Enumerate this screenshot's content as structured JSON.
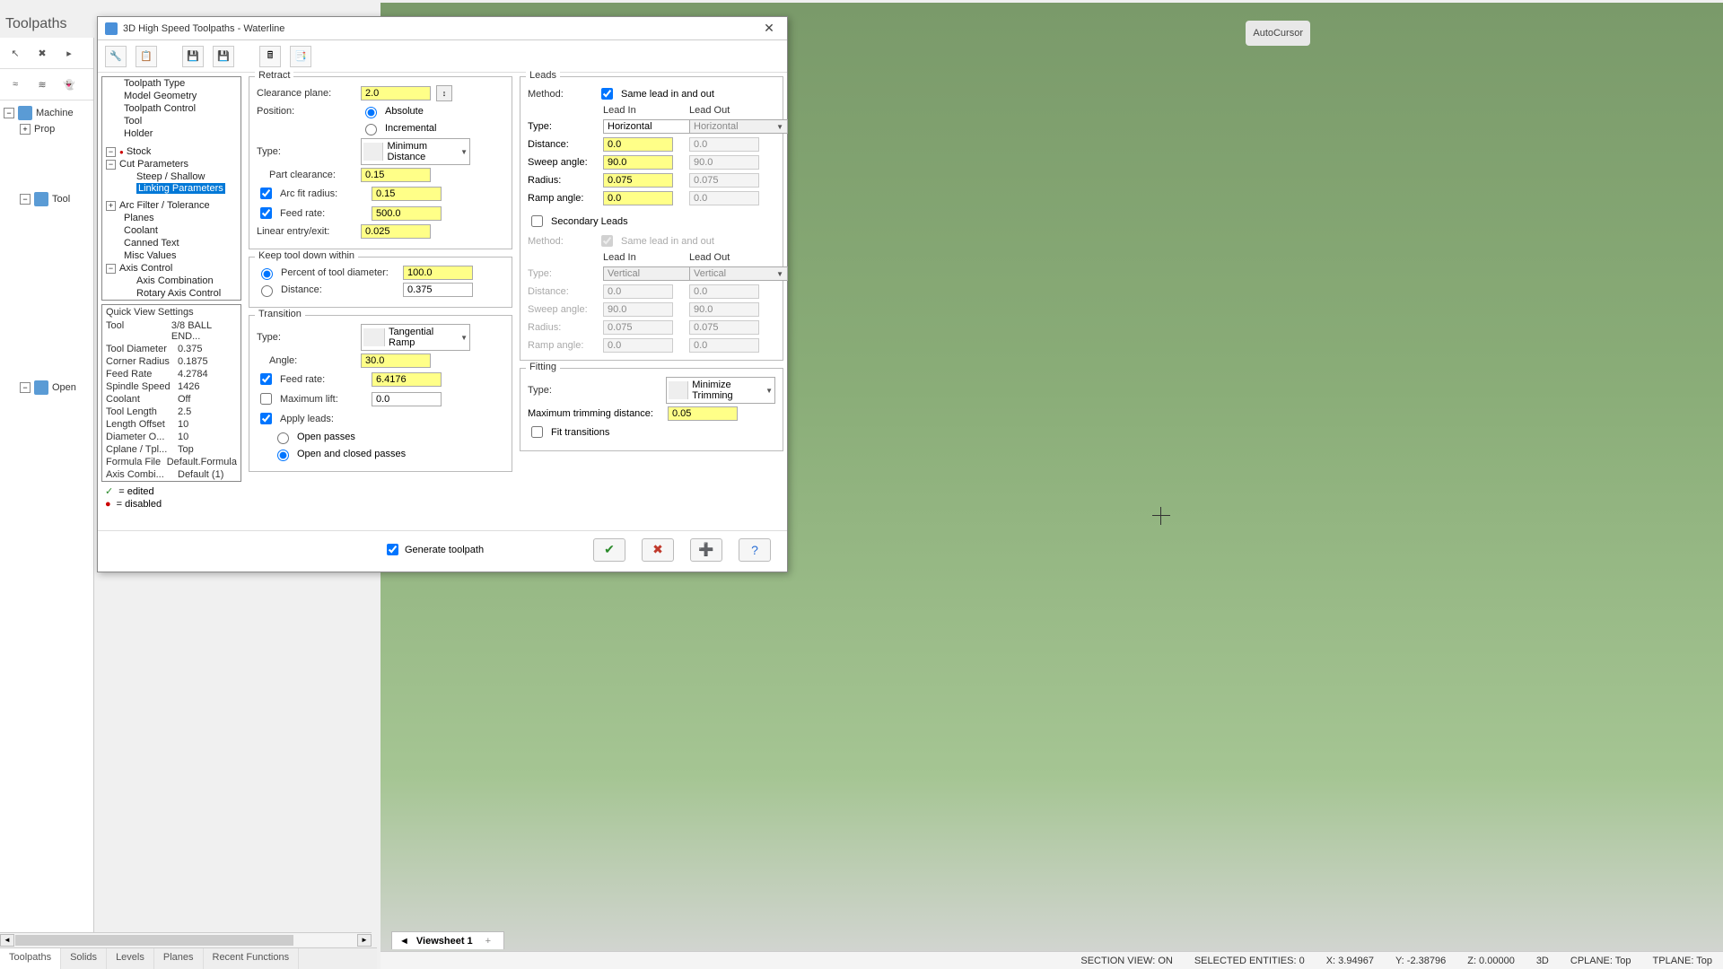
{
  "panel_title": "Toolpaths",
  "sidebar_tree": {
    "machine": "Machine",
    "properties": "Prop",
    "toolpath": "Tool",
    "operations": "Open"
  },
  "bottom_tabs": [
    "Toolpaths",
    "Solids",
    "Levels",
    "Planes",
    "Recent Functions"
  ],
  "viewport_toolbar": {
    "autocursor": "AutoCursor"
  },
  "viewsheet": {
    "label": "Viewsheet 1"
  },
  "status": {
    "section": "SECTION VIEW: ON",
    "selected": "SELECTED ENTITIES: 0",
    "x": "X: 3.94967",
    "y": "Y: -2.38796",
    "z": "Z: 0.00000",
    "mode": "3D",
    "cplane": "CPLANE: Top",
    "tplane": "TPLANE: Top"
  },
  "dialog": {
    "title": "3D High Speed Toolpaths - Waterline",
    "tree": [
      "Toolpath Type",
      "Model Geometry",
      "Toolpath Control",
      "Tool",
      "Holder",
      "Stock",
      "Cut Parameters",
      "Steep / Shallow",
      "Linking Parameters",
      "Arc Filter / Tolerance",
      "Planes",
      "Coolant",
      "Canned Text",
      "Misc Values",
      "Axis Control",
      "Axis Combination",
      "Rotary Axis Control"
    ],
    "quickview_title": "Quick View Settings",
    "quickview": [
      {
        "l": "Tool",
        "v": "3/8 BALL END..."
      },
      {
        "l": "Tool Diameter",
        "v": "0.375"
      },
      {
        "l": "Corner Radius",
        "v": "0.1875"
      },
      {
        "l": "Feed Rate",
        "v": "4.2784"
      },
      {
        "l": "Spindle Speed",
        "v": "1426"
      },
      {
        "l": "Coolant",
        "v": "Off"
      },
      {
        "l": "Tool Length",
        "v": "2.5"
      },
      {
        "l": "Length Offset",
        "v": "10"
      },
      {
        "l": "Diameter O...",
        "v": "10"
      },
      {
        "l": "Cplane / Tpl...",
        "v": "Top"
      },
      {
        "l": "Formula File",
        "v": "Default.Formula"
      },
      {
        "l": "Axis Combi...",
        "v": "Default (1)"
      }
    ],
    "legend": {
      "edited": "= edited",
      "disabled": "= disabled"
    },
    "retract": {
      "title": "Retract",
      "clearance_label": "Clearance plane:",
      "clearance": "2.0",
      "position_label": "Position:",
      "absolute": "Absolute",
      "incremental": "Incremental",
      "type_label": "Type:",
      "type": "Minimum Distance",
      "part_clearance_label": "Part clearance:",
      "part_clearance": "0.15",
      "arc_fit_label": "Arc fit radius:",
      "arc_fit": "0.15",
      "feed_rate_label": "Feed rate:",
      "feed_rate": "500.0",
      "linear_label": "Linear entry/exit:",
      "linear": "0.025"
    },
    "keep_tool": {
      "title": "Keep tool down within",
      "percent_label": "Percent of tool diameter:",
      "percent": "100.0",
      "distance_label": "Distance:",
      "distance": "0.375"
    },
    "transition": {
      "title": "Transition",
      "type_label": "Type:",
      "type": "Tangential Ramp",
      "angle_label": "Angle:",
      "angle": "30.0",
      "feed_rate_label": "Feed rate:",
      "feed_rate": "6.4176",
      "max_lift_label": "Maximum lift:",
      "max_lift": "0.0",
      "apply_leads_label": "Apply leads:",
      "open_passes": "Open passes",
      "open_closed": "Open and closed passes"
    },
    "leads": {
      "title": "Leads",
      "method_label": "Method:",
      "same_label": "Same lead in and out",
      "lead_in": "Lead In",
      "lead_out": "Lead Out",
      "type_label": "Type:",
      "type_in": "Horizontal",
      "type_out": "Horizontal",
      "distance_label": "Distance:",
      "distance_in": "0.0",
      "distance_out": "0.0",
      "sweep_label": "Sweep angle:",
      "sweep_in": "90.0",
      "sweep_out": "90.0",
      "radius_label": "Radius:",
      "radius_in": "0.075",
      "radius_out": "0.075",
      "ramp_label": "Ramp angle:",
      "ramp_in": "0.0",
      "ramp_out": "0.0"
    },
    "secondary": {
      "label": "Secondary Leads",
      "method_label": "Method:",
      "same_label": "Same lead in and out",
      "lead_in": "Lead In",
      "lead_out": "Lead Out",
      "type_label": "Type:",
      "type_in": "Vertical",
      "type_out": "Vertical",
      "distance_label": "Distance:",
      "distance_in": "0.0",
      "distance_out": "0.0",
      "sweep_label": "Sweep angle:",
      "sweep_in": "90.0",
      "sweep_out": "90.0",
      "radius_label": "Radius:",
      "radius_in": "0.075",
      "radius_out": "0.075",
      "ramp_label": "Ramp angle:",
      "ramp_in": "0.0",
      "ramp_out": "0.0"
    },
    "fitting": {
      "title": "Fitting",
      "type_label": "Type:",
      "type": "Minimize Trimming",
      "max_label": "Maximum trimming distance:",
      "max": "0.05",
      "fit_transitions": "Fit transitions"
    },
    "footer": {
      "generate": "Generate toolpath"
    }
  }
}
